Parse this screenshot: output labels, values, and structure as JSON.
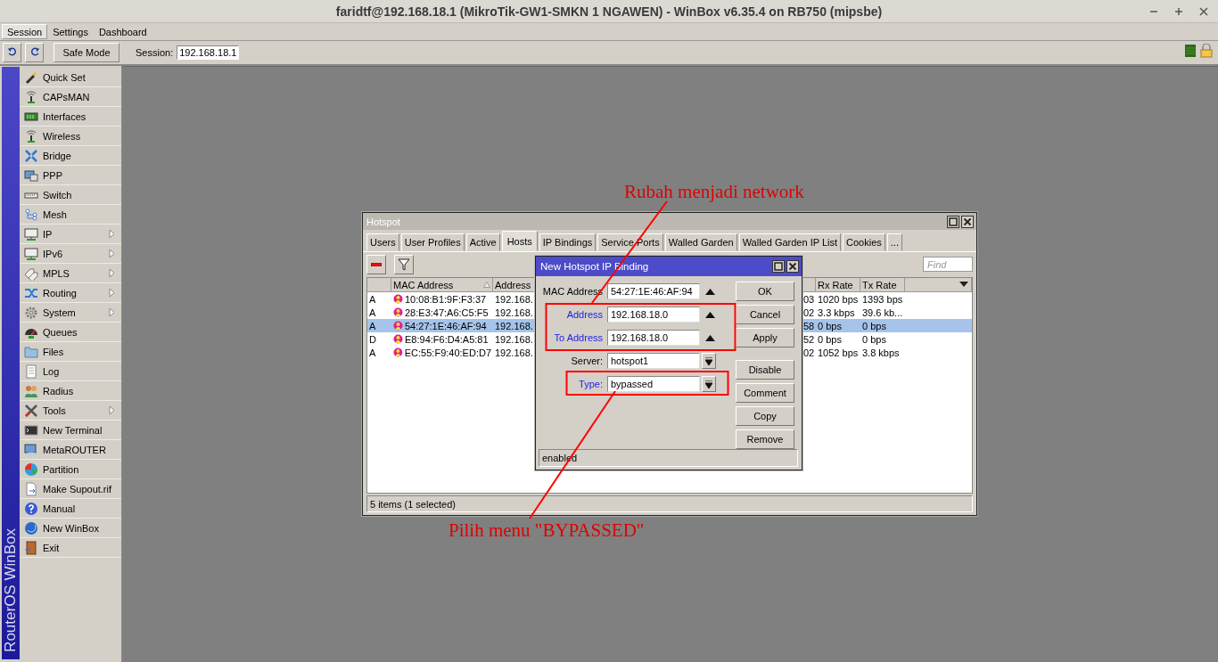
{
  "window": {
    "title": "faridtf@192.168.18.1 (MikroTik-GW1-SMKN 1 NGAWEN) - WinBox v6.35.4 on RB750 (mipsbe)"
  },
  "menu_bar": [
    {
      "label": "Session",
      "selected": true
    },
    {
      "label": "Settings",
      "selected": false
    },
    {
      "label": "Dashboard",
      "selected": false
    }
  ],
  "toolbar": {
    "safe_mode": "Safe Mode",
    "session_label": "Session:",
    "session_value": "192.168.18.1"
  },
  "sidebar": {
    "brand": "RouterOS WinBox",
    "items": [
      {
        "label": "Quick Set",
        "submenu": false
      },
      {
        "label": "CAPsMAN",
        "submenu": false
      },
      {
        "label": "Interfaces",
        "submenu": false
      },
      {
        "label": "Wireless",
        "submenu": false
      },
      {
        "label": "Bridge",
        "submenu": false
      },
      {
        "label": "PPP",
        "submenu": false
      },
      {
        "label": "Switch",
        "submenu": false
      },
      {
        "label": "Mesh",
        "submenu": false
      },
      {
        "label": "IP",
        "submenu": true
      },
      {
        "label": "IPv6",
        "submenu": true
      },
      {
        "label": "MPLS",
        "submenu": true
      },
      {
        "label": "Routing",
        "submenu": true
      },
      {
        "label": "System",
        "submenu": true
      },
      {
        "label": "Queues",
        "submenu": false
      },
      {
        "label": "Files",
        "submenu": false
      },
      {
        "label": "Log",
        "submenu": false
      },
      {
        "label": "Radius",
        "submenu": false
      },
      {
        "label": "Tools",
        "submenu": true
      },
      {
        "label": "New Terminal",
        "submenu": false
      },
      {
        "label": "MetaROUTER",
        "submenu": false
      },
      {
        "label": "Partition",
        "submenu": false
      },
      {
        "label": "Make Supout.rif",
        "submenu": false
      },
      {
        "label": "Manual",
        "submenu": false
      },
      {
        "label": "New WinBox",
        "submenu": false
      },
      {
        "label": "Exit",
        "submenu": false
      }
    ]
  },
  "hotspot": {
    "title": "Hotspot",
    "tabs": [
      {
        "label": "Users",
        "selected": false
      },
      {
        "label": "User Profiles",
        "selected": false
      },
      {
        "label": "Active",
        "selected": false
      },
      {
        "label": "Hosts",
        "selected": true
      },
      {
        "label": "IP Bindings",
        "selected": false
      },
      {
        "label": "Service Ports",
        "selected": false
      },
      {
        "label": "Walled Garden",
        "selected": false
      },
      {
        "label": "Walled Garden IP List",
        "selected": false
      },
      {
        "label": "Cookies",
        "selected": false
      },
      {
        "label": "...",
        "selected": false
      }
    ],
    "find": {
      "placeholder": "Find"
    },
    "columns": [
      {
        "label": "MAC Address",
        "sorted": true
      },
      {
        "label": "Address",
        "sorted": false
      },
      {
        "label": "Rx Rate",
        "sorted": false
      },
      {
        "label": "Tx Rate",
        "sorted": false
      }
    ],
    "rows": [
      {
        "flag": "A",
        "mac_address": "10:08:B1:9F:F3:37",
        "address": "192.168.",
        "column_4": "03",
        "rx_rate": "1020 bps",
        "tx_rate": "1393 bps",
        "selected": false
      },
      {
        "flag": "A",
        "mac_address": "28:E3:47:A6:C5:F5",
        "address": "192.168.",
        "column_4": "02",
        "rx_rate": "3.3 kbps",
        "tx_rate": "39.6 kb...",
        "selected": false
      },
      {
        "flag": "A",
        "mac_address": "54:27:1E:46:AF:94",
        "address": "192.168.",
        "column_4": "58",
        "rx_rate": "0 bps",
        "tx_rate": "0 bps",
        "selected": true
      },
      {
        "flag": "D",
        "mac_address": "E8:94:F6:D4:A5:81",
        "address": "192.168.",
        "column_4": "52",
        "rx_rate": "0 bps",
        "tx_rate": "0 bps",
        "selected": false
      },
      {
        "flag": "A",
        "mac_address": "EC:55:F9:40:ED:D7",
        "address": "192.168.",
        "column_4": "02",
        "rx_rate": "1052 bps",
        "tx_rate": "3.8 kbps",
        "selected": false
      }
    ],
    "status": "5 items (1 selected)"
  },
  "dialog": {
    "title": "New Hotspot IP Binding",
    "fields": [
      {
        "label": "MAC Address",
        "value": "54:27:1E:46:AF:94",
        "kind": "address",
        "modified": false
      },
      {
        "label": "Address",
        "value": "192.168.18.0",
        "kind": "address",
        "modified": true
      },
      {
        "label": "To Address",
        "value": "192.168.18.0",
        "kind": "address",
        "modified": true
      },
      {
        "label": "Server:",
        "value": "hotspot1",
        "kind": "select",
        "modified": false
      },
      {
        "label": "Type:",
        "value": "bypassed",
        "kind": "select",
        "modified": true
      }
    ],
    "buttons": [
      {
        "label": "OK"
      },
      {
        "label": "Cancel"
      },
      {
        "label": "Apply"
      },
      {
        "label": "Disable"
      },
      {
        "label": "Comment"
      },
      {
        "label": "Copy"
      },
      {
        "label": "Remove"
      }
    ],
    "status": "enabled"
  },
  "annotations": [
    {
      "text": "Rubah menjadi network"
    },
    {
      "text": "Pilih menu \"BYPASSED\""
    }
  ]
}
